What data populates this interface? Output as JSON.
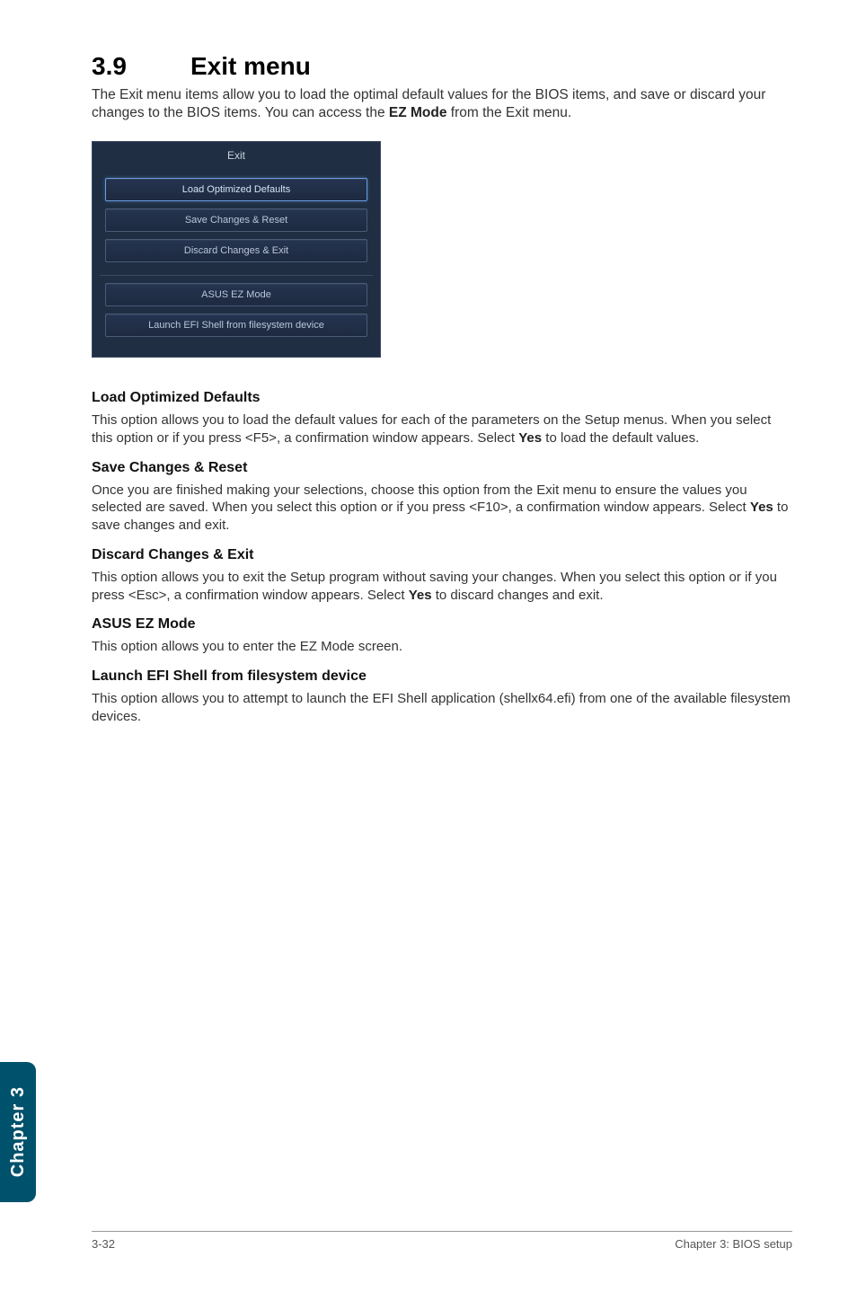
{
  "section": {
    "number": "3.9",
    "title": "Exit menu",
    "intro_a": "The Exit menu items allow you to load the optimal default values for the BIOS items, and save or discard your changes to the BIOS items. You can access the ",
    "intro_bold": "EZ Mode",
    "intro_b": " from the Exit menu."
  },
  "bios": {
    "title": "Exit",
    "items": [
      "Load Optimized Defaults",
      "Save Changes & Reset",
      "Discard Changes & Exit"
    ],
    "items2": [
      "ASUS EZ Mode",
      "Launch EFI Shell from filesystem device"
    ]
  },
  "blocks": [
    {
      "head": "Load Optimized Defaults",
      "p_a": "This option allows you to load the default values for each of the parameters on the Setup menus. When you select this option or if you press <F5>, a confirmation window appears. Select ",
      "p_bold": "Yes",
      "p_b": " to load the default values."
    },
    {
      "head": "Save Changes & Reset",
      "p_a": "Once you are finished making your selections, choose this option from the Exit menu to ensure the values you selected are saved. When you select this option or if you press <F10>, a confirmation window appears. Select ",
      "p_bold": "Yes",
      "p_b": " to save changes and exit."
    },
    {
      "head": "Discard Changes & Exit",
      "p_a": "This option allows you to exit the Setup program without saving your changes. When you select this option or if you press <Esc>, a confirmation window appears. Select ",
      "p_bold": "Yes",
      "p_b": " to discard changes and exit."
    },
    {
      "head": "ASUS EZ Mode",
      "p_a": "This option allows you to enter the EZ Mode screen.",
      "p_bold": "",
      "p_b": ""
    },
    {
      "head": "Launch EFI Shell from filesystem device",
      "p_a": "This option allows you to attempt to launch the EFI Shell application (shellx64.efi) from one of the available filesystem devices.",
      "p_bold": "",
      "p_b": ""
    }
  ],
  "sidetab": "Chapter 3",
  "footer": {
    "left": "3-32",
    "right": "Chapter 3: BIOS setup"
  }
}
